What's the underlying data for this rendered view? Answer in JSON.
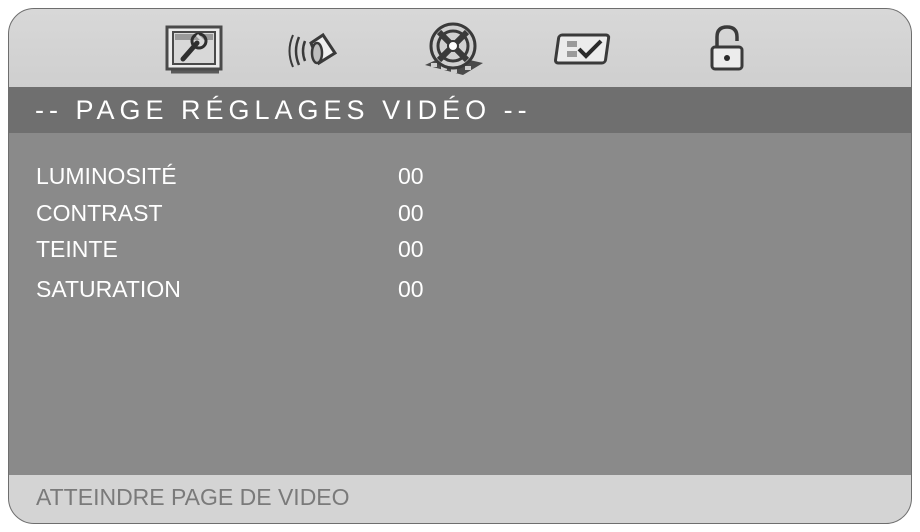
{
  "toolbar": {
    "icons": [
      {
        "name": "general-setup-icon",
        "selected": false
      },
      {
        "name": "audio-setup-icon",
        "selected": false
      },
      {
        "name": "video-setup-icon",
        "selected": true
      },
      {
        "name": "preference-setup-icon",
        "selected": false
      },
      {
        "name": "password-setup-icon",
        "selected": false
      }
    ]
  },
  "page": {
    "title": "-- PAGE RÉGLAGES VIDÉO --"
  },
  "settings": [
    {
      "label": "LUMINOSITÉ",
      "value": "00"
    },
    {
      "label": "CONTRAST",
      "value": "00"
    },
    {
      "label": "TEINTE",
      "value": "00"
    },
    {
      "label": "SATURATION",
      "value": "00"
    }
  ],
  "status": {
    "text": "ATTEINDRE PAGE DE VIDEO"
  },
  "colors": {
    "panel": "#8a8a8a",
    "title_bar": "#6f6f6f",
    "toolbar": "#d3d3d3",
    "status_bar": "#d4d4d4",
    "text": "#ffffff"
  }
}
